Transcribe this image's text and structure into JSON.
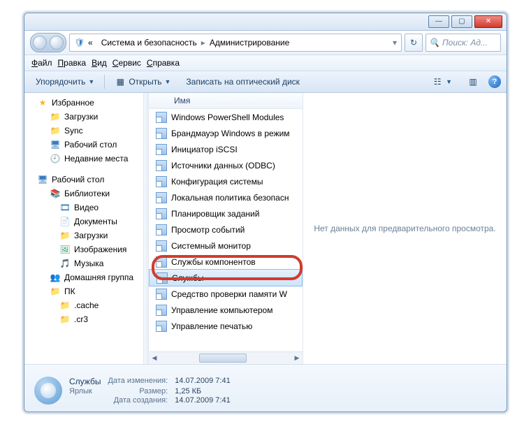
{
  "breadcrumb": {
    "back": "«",
    "seg1": "Система и безопасность",
    "seg2": "Администрирование"
  },
  "search": {
    "placeholder": "Поиск: Ад..."
  },
  "menu": {
    "file": "Файл",
    "edit": "Правка",
    "view": "Вид",
    "tools": "Сервис",
    "help": "Справка"
  },
  "toolbar": {
    "organize": "Упорядочить",
    "open": "Открыть",
    "burn": "Записать на оптический диск"
  },
  "nav": {
    "fav": "Избранное",
    "fav_items": {
      "downloads": "Загрузки",
      "sync": "Sync",
      "desktop": "Рабочий стол",
      "recent": "Недавние места"
    },
    "desktop": "Рабочий стол",
    "libs": "Библиотеки",
    "lib_items": {
      "video": "Видео",
      "docs": "Документы",
      "dls": "Загрузки",
      "pics": "Изображения",
      "music": "Музыка"
    },
    "homegroup": "Домашняя группа",
    "pc": "ПК",
    "pc_items": {
      "cache": ".cache",
      "cr3": ".cr3"
    }
  },
  "list": {
    "header": "Имя",
    "items": [
      "Windows PowerShell Modules",
      "Брандмауэр Windows в режим",
      "Инициатор iSCSI",
      "Источники данных (ODBC)",
      "Конфигурация системы",
      "Локальная политика безопасн",
      "Планировщик заданий",
      "Просмотр событий",
      "Системный монитор",
      "Службы компонентов",
      "Службы",
      "Средство проверки памяти W",
      "Управление компьютером",
      "Управление печатью"
    ]
  },
  "preview": {
    "empty": "Нет данных для предварительного просмотра."
  },
  "details": {
    "name": "Службы",
    "type": "Ярлык",
    "labels": {
      "modified": "Дата изменения:",
      "size": "Размер:",
      "created": "Дата создания:"
    },
    "values": {
      "modified": "14.07.2009 7:41",
      "size": "1,25 КБ",
      "created": "14.07.2009 7:41"
    }
  }
}
